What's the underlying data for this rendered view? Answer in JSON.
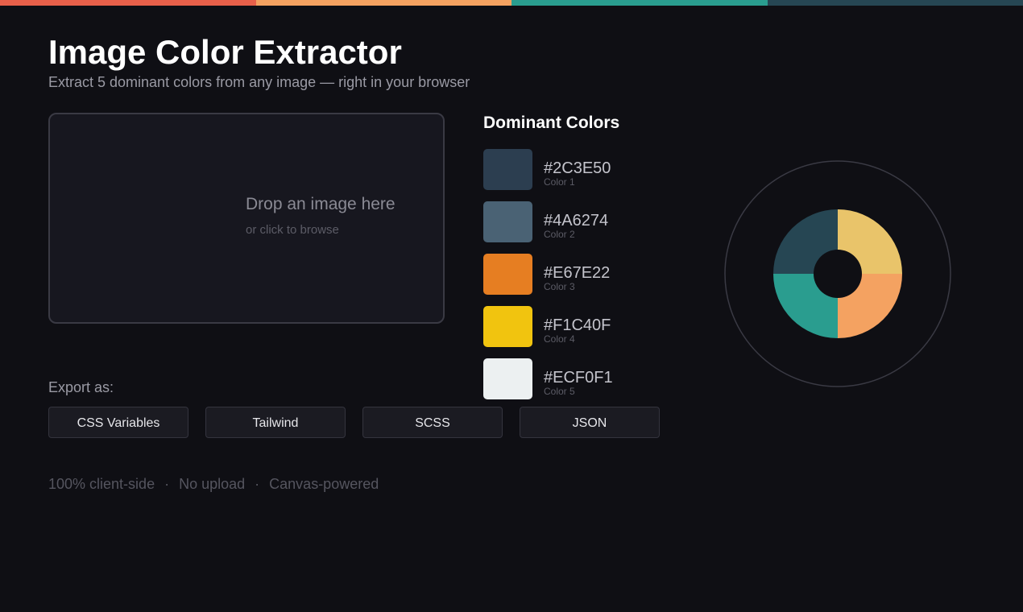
{
  "app": {
    "title": "Image Color Extractor",
    "subtitle": "Extract 5 dominant colors from any image — right in your browser"
  },
  "topbar_colors": [
    "#e8604a",
    "#f4a261",
    "#2a9d8f",
    "#264653"
  ],
  "dropzone": {
    "title": "Drop an image here",
    "subtitle": "or click to browse"
  },
  "palette": {
    "heading": "Dominant Colors",
    "colors": [
      {
        "hex": "#2C3E50",
        "label": "Color 1"
      },
      {
        "hex": "#4A6274",
        "label": "Color 2"
      },
      {
        "hex": "#E67E22",
        "label": "Color 3"
      },
      {
        "hex": "#F1C40F",
        "label": "Color 4"
      },
      {
        "hex": "#ECF0F1",
        "label": "Color 5"
      }
    ]
  },
  "wheel_colors": [
    "#e9c46a",
    "#f4a261",
    "#2a9d8f",
    "#264653"
  ],
  "export": {
    "label": "Export as:",
    "buttons": [
      "CSS Variables",
      "Tailwind",
      "SCSS",
      "JSON"
    ]
  },
  "footer": {
    "items": [
      "100% client-side",
      "No upload",
      "Canvas-powered"
    ],
    "separator": "·"
  }
}
